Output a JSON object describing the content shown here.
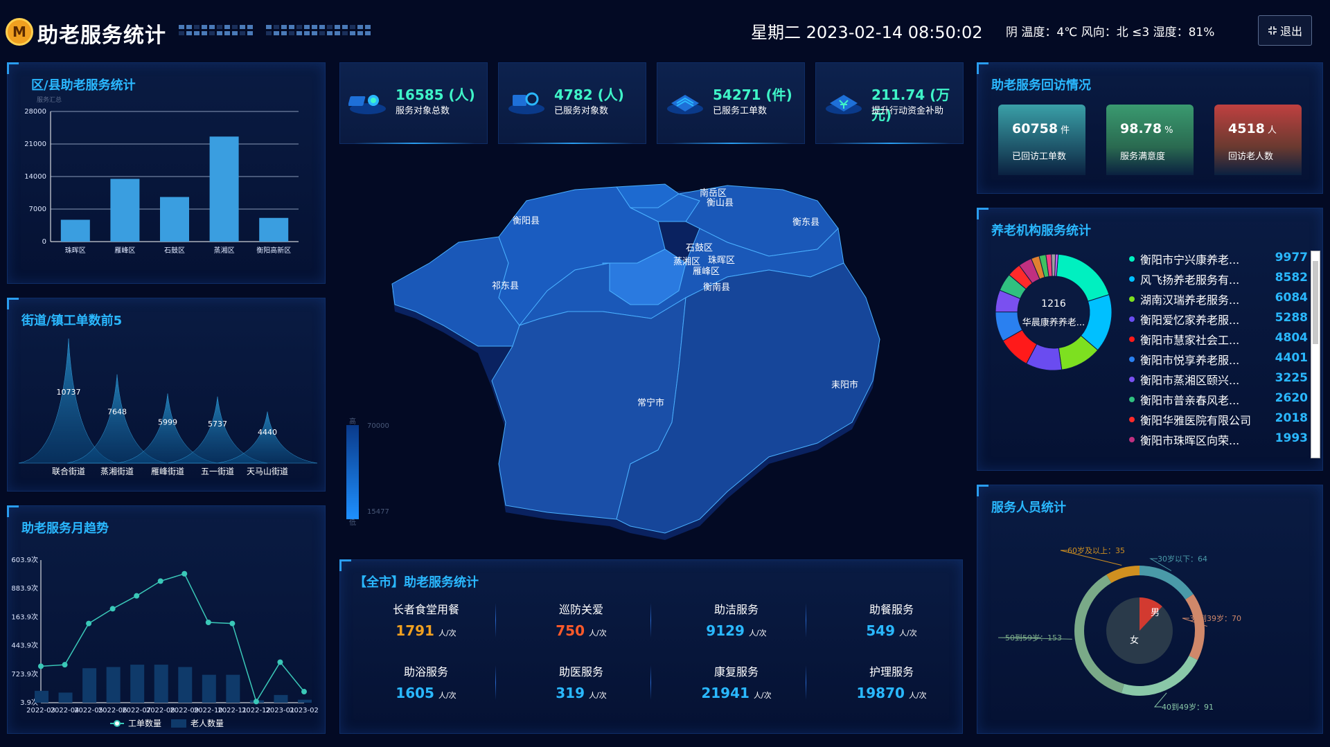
{
  "header": {
    "logo_icon": "logo-m-icon",
    "title": "助老服务统计",
    "datetime": "星期二 2023-02-14 08:50:02",
    "weather": "阴  温度：4℃  风向：北 ≤3  湿度：81%",
    "exit_label": "退出",
    "exit_icon": "fullscreen-exit-icon"
  },
  "district_panel": {
    "title": "区/县助老服务统计",
    "legend_caption": "服务汇总",
    "chart_data": {
      "type": "bar",
      "categories": [
        "珠晖区",
        "雁峰区",
        "石鼓区",
        "蒸湘区",
        "衡阳高新区"
      ],
      "values": [
        4700,
        13500,
        9600,
        22600,
        5100
      ],
      "ylim": [
        0,
        28000
      ],
      "yticks": [
        0,
        7000,
        14000,
        21000,
        28000
      ],
      "color": "#3a9ee0"
    }
  },
  "street_panel": {
    "title": "街道/镇工单数前5",
    "chart_data": {
      "type": "bar",
      "categories": [
        "联合街道",
        "蒸湘街道",
        "雁峰街道",
        "五一街道",
        "天马山街道"
      ],
      "values": [
        10737,
        7648,
        5999,
        5737,
        4440
      ]
    }
  },
  "monthly_panel": {
    "title": "助老服务月趋势",
    "chart_data": {
      "type": "line",
      "x": [
        "2022-03",
        "2022-04",
        "2022-05",
        "2022-06",
        "2022-07",
        "2022-08",
        "2022-09",
        "2022-10",
        "2022-11",
        "2022-12",
        "2023-01",
        "2023-02"
      ],
      "ytick_labels": [
        "3.9次",
        "723.9次",
        "443.9次",
        "163.9次",
        "883.9次",
        "603.9次"
      ],
      "series": [
        {
          "name": "工单数量",
          "type": "line",
          "values": [
            990,
            1030,
            2150,
            2550,
            2900,
            3300,
            3500,
            2180,
            2150,
            30,
            1100,
            300
          ]
        },
        {
          "name": "老人数量",
          "type": "bar",
          "values": [
            200,
            170,
            580,
            600,
            640,
            640,
            600,
            470,
            470,
            40,
            130,
            50
          ]
        }
      ],
      "ylim": [
        0,
        6000
      ]
    }
  },
  "stats": [
    {
      "value": "16585 (人)",
      "label": "服务对象总数",
      "icon": "people-icon"
    },
    {
      "value": "4782 (人)",
      "label": "已服务对象数",
      "icon": "served-people-icon"
    },
    {
      "value": "54271 (件)",
      "label": "已服务工单数",
      "icon": "workorder-icon"
    },
    {
      "value": "211.74 (万元)",
      "label": "提升行动资金补助",
      "icon": "funding-icon"
    }
  ],
  "map": {
    "regions": [
      "南岳区",
      "衡山县",
      "衡阳县",
      "衡东县",
      "石鼓区",
      "蒸湘区",
      "珠晖区",
      "雁峰区",
      "衡南县",
      "祁东县",
      "常宁市",
      "耒阳市"
    ],
    "legend_high_label": "高",
    "legend_low_label": "低",
    "legend_max": "70000",
    "legend_min": "15477"
  },
  "citywide_panel": {
    "title": "【全市】助老服务统计",
    "unit": "人/次",
    "services": [
      {
        "name": "长者食堂用餐",
        "value": "1791",
        "color": "#f0a020"
      },
      {
        "name": "巡防关爱",
        "value": "750",
        "color": "#ff5a2a"
      },
      {
        "name": "助洁服务",
        "value": "9129",
        "color": "#2ab8ff"
      },
      {
        "name": "助餐服务",
        "value": "549",
        "color": "#2ab8ff"
      },
      {
        "name": "助浴服务",
        "value": "1605",
        "color": "#2ab8ff"
      },
      {
        "name": "助医服务",
        "value": "319",
        "color": "#2ab8ff"
      },
      {
        "name": "康复服务",
        "value": "21941",
        "color": "#2ab8ff"
      },
      {
        "name": "护理服务",
        "value": "19870",
        "color": "#2ab8ff"
      }
    ]
  },
  "visit_panel": {
    "title": "助老服务回访情况",
    "cards": [
      {
        "value": "60758",
        "unit": "件",
        "label": "已回访工单数"
      },
      {
        "value": "98.78",
        "unit": "%",
        "label": "服务满意度"
      },
      {
        "value": "4518",
        "unit": "人",
        "label": "回访老人数"
      }
    ]
  },
  "org_panel": {
    "title": "养老机构服务统计",
    "donut_center_value": "1216",
    "donut_center_label": "华晨康养养老...",
    "orgs": [
      {
        "name": "衡阳市宁兴康养老...",
        "value": "9977",
        "color": "#00f0c0"
      },
      {
        "name": "风飞扬养老服务有...",
        "value": "8582",
        "color": "#00c0ff"
      },
      {
        "name": "湖南汉瑞养老服务...",
        "value": "6084",
        "color": "#7de020"
      },
      {
        "name": "衡阳爱忆家养老服...",
        "value": "5288",
        "color": "#6a4cf0"
      },
      {
        "name": "衡阳市慧家社会工...",
        "value": "4804",
        "color": "#ff1a1a"
      },
      {
        "name": "衡阳市悦享养老服...",
        "value": "4401",
        "color": "#2a80f0"
      },
      {
        "name": "衡阳市蒸湘区颐兴...",
        "value": "3225",
        "color": "#7a50f0"
      },
      {
        "name": "衡阳市普亲春风老...",
        "value": "2620",
        "color": "#30c080"
      },
      {
        "name": "衡阳华雅医院有限公司",
        "value": "2018",
        "color": "#ff2a2a"
      },
      {
        "name": "衡阳市珠晖区向荣...",
        "value": "1993",
        "color": "#c03080"
      },
      {
        "name": "华晨康养养老连锁...",
        "value": "1216",
        "color": "#e08030"
      }
    ],
    "chart_data": {
      "type": "pie",
      "values": [
        9977,
        8582,
        6084,
        5288,
        4804,
        4401,
        3225,
        2620,
        2018,
        1993,
        1216,
        1000,
        800,
        600,
        400
      ]
    }
  },
  "staff_panel": {
    "title": "服务人员统计",
    "inner_labels": [
      "男",
      "女"
    ],
    "chart_data": {
      "type": "pie",
      "categories": [
        "30岁以下",
        "30到39岁",
        "40到49岁",
        "50到59岁",
        "60岁及以上"
      ],
      "values": [
        64,
        70,
        91,
        153,
        35
      ],
      "labels": [
        "30岁以下：64",
        "30到39岁：70",
        "40到49岁：91",
        "50到59岁：153",
        "60岁及以上：35"
      ],
      "colors": [
        "#4a9aa8",
        "#d0886a",
        "#8ac8a8",
        "#7aaa88",
        "#d09020"
      ],
      "inner_values": [
        12,
        88
      ],
      "inner_colors": [
        "#d23a30",
        "#2a3a4a"
      ]
    }
  }
}
